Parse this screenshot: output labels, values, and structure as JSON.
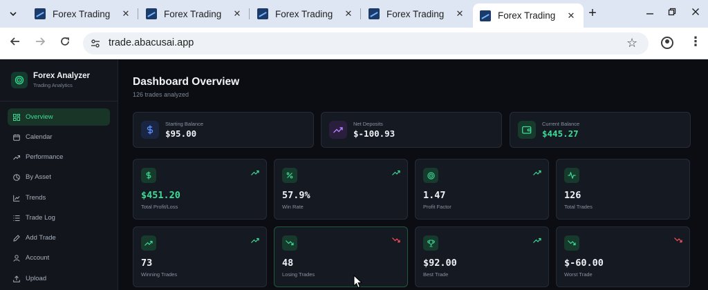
{
  "browser": {
    "tabs": [
      {
        "title": "Forex Trading",
        "active": false
      },
      {
        "title": "Forex Trading",
        "active": false
      },
      {
        "title": "Forex Trading",
        "active": false
      },
      {
        "title": "Forex Trading",
        "active": false
      },
      {
        "title": "Forex Trading",
        "active": true
      }
    ],
    "url": "trade.abacusai.app"
  },
  "app": {
    "name": "Forex Analyzer",
    "subtitle": "Trading Analytics",
    "accent": "#3ddc97"
  },
  "sidebar": {
    "items": [
      {
        "label": "Overview",
        "icon": "grid-icon",
        "active": true
      },
      {
        "label": "Calendar",
        "icon": "calendar-icon",
        "active": false
      },
      {
        "label": "Performance",
        "icon": "trending-up-icon",
        "active": false
      },
      {
        "label": "By Asset",
        "icon": "pie-icon",
        "active": false
      },
      {
        "label": "Trends",
        "icon": "line-chart-icon",
        "active": false
      },
      {
        "label": "Trade Log",
        "icon": "list-icon",
        "active": false
      },
      {
        "label": "Add Trade",
        "icon": "pencil-icon",
        "active": false
      },
      {
        "label": "Account",
        "icon": "user-icon",
        "active": false
      },
      {
        "label": "Upload",
        "icon": "upload-icon",
        "active": false
      }
    ]
  },
  "dashboard": {
    "title": "Dashboard Overview",
    "subtitle": "126 trades analyzed",
    "balances": [
      {
        "label": "Starting Balance",
        "value": "$95.00",
        "icon": "dollar-icon"
      },
      {
        "label": "Net Deposits",
        "value": "$-100.93",
        "icon": "trending-up-icon"
      },
      {
        "label": "Current Balance",
        "value": "$445.27",
        "icon": "wallet-icon"
      }
    ],
    "stats": [
      {
        "label": "Total Profit/Loss",
        "value": "$451.20",
        "icon": "dollar-icon",
        "trend": "up"
      },
      {
        "label": "Win Rate",
        "value": "57.9%",
        "icon": "percent-icon",
        "trend": "up"
      },
      {
        "label": "Profit Factor",
        "value": "1.47",
        "icon": "target-icon",
        "trend": "up"
      },
      {
        "label": "Total Trades",
        "value": "126",
        "icon": "activity-icon",
        "trend": "none"
      },
      {
        "label": "Winning Trades",
        "value": "73",
        "icon": "trending-up-icon",
        "trend": "up"
      },
      {
        "label": "Losing Trades",
        "value": "48",
        "icon": "trending-down-icon",
        "trend": "down"
      },
      {
        "label": "Best Trade",
        "value": "$92.00",
        "icon": "trophy-icon",
        "trend": "up"
      },
      {
        "label": "Worst Trade",
        "value": "$-60.00",
        "icon": "trending-down-icon",
        "trend": "down"
      }
    ]
  }
}
